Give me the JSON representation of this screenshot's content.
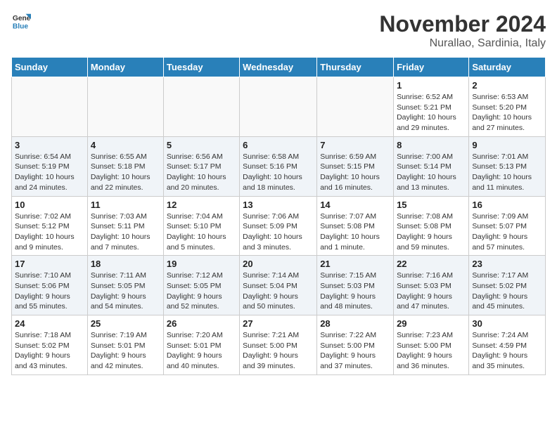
{
  "logo": {
    "line1": "General",
    "line2": "Blue"
  },
  "title": "November 2024",
  "location": "Nurallao, Sardinia, Italy",
  "weekdays": [
    "Sunday",
    "Monday",
    "Tuesday",
    "Wednesday",
    "Thursday",
    "Friday",
    "Saturday"
  ],
  "weeks": [
    [
      {
        "day": "",
        "info": ""
      },
      {
        "day": "",
        "info": ""
      },
      {
        "day": "",
        "info": ""
      },
      {
        "day": "",
        "info": ""
      },
      {
        "day": "",
        "info": ""
      },
      {
        "day": "1",
        "info": "Sunrise: 6:52 AM\nSunset: 5:21 PM\nDaylight: 10 hours\nand 29 minutes."
      },
      {
        "day": "2",
        "info": "Sunrise: 6:53 AM\nSunset: 5:20 PM\nDaylight: 10 hours\nand 27 minutes."
      }
    ],
    [
      {
        "day": "3",
        "info": "Sunrise: 6:54 AM\nSunset: 5:19 PM\nDaylight: 10 hours\nand 24 minutes."
      },
      {
        "day": "4",
        "info": "Sunrise: 6:55 AM\nSunset: 5:18 PM\nDaylight: 10 hours\nand 22 minutes."
      },
      {
        "day": "5",
        "info": "Sunrise: 6:56 AM\nSunset: 5:17 PM\nDaylight: 10 hours\nand 20 minutes."
      },
      {
        "day": "6",
        "info": "Sunrise: 6:58 AM\nSunset: 5:16 PM\nDaylight: 10 hours\nand 18 minutes."
      },
      {
        "day": "7",
        "info": "Sunrise: 6:59 AM\nSunset: 5:15 PM\nDaylight: 10 hours\nand 16 minutes."
      },
      {
        "day": "8",
        "info": "Sunrise: 7:00 AM\nSunset: 5:14 PM\nDaylight: 10 hours\nand 13 minutes."
      },
      {
        "day": "9",
        "info": "Sunrise: 7:01 AM\nSunset: 5:13 PM\nDaylight: 10 hours\nand 11 minutes."
      }
    ],
    [
      {
        "day": "10",
        "info": "Sunrise: 7:02 AM\nSunset: 5:12 PM\nDaylight: 10 hours\nand 9 minutes."
      },
      {
        "day": "11",
        "info": "Sunrise: 7:03 AM\nSunset: 5:11 PM\nDaylight: 10 hours\nand 7 minutes."
      },
      {
        "day": "12",
        "info": "Sunrise: 7:04 AM\nSunset: 5:10 PM\nDaylight: 10 hours\nand 5 minutes."
      },
      {
        "day": "13",
        "info": "Sunrise: 7:06 AM\nSunset: 5:09 PM\nDaylight: 10 hours\nand 3 minutes."
      },
      {
        "day": "14",
        "info": "Sunrise: 7:07 AM\nSunset: 5:08 PM\nDaylight: 10 hours\nand 1 minute."
      },
      {
        "day": "15",
        "info": "Sunrise: 7:08 AM\nSunset: 5:08 PM\nDaylight: 9 hours\nand 59 minutes."
      },
      {
        "day": "16",
        "info": "Sunrise: 7:09 AM\nSunset: 5:07 PM\nDaylight: 9 hours\nand 57 minutes."
      }
    ],
    [
      {
        "day": "17",
        "info": "Sunrise: 7:10 AM\nSunset: 5:06 PM\nDaylight: 9 hours\nand 55 minutes."
      },
      {
        "day": "18",
        "info": "Sunrise: 7:11 AM\nSunset: 5:05 PM\nDaylight: 9 hours\nand 54 minutes."
      },
      {
        "day": "19",
        "info": "Sunrise: 7:12 AM\nSunset: 5:05 PM\nDaylight: 9 hours\nand 52 minutes."
      },
      {
        "day": "20",
        "info": "Sunrise: 7:14 AM\nSunset: 5:04 PM\nDaylight: 9 hours\nand 50 minutes."
      },
      {
        "day": "21",
        "info": "Sunrise: 7:15 AM\nSunset: 5:03 PM\nDaylight: 9 hours\nand 48 minutes."
      },
      {
        "day": "22",
        "info": "Sunrise: 7:16 AM\nSunset: 5:03 PM\nDaylight: 9 hours\nand 47 minutes."
      },
      {
        "day": "23",
        "info": "Sunrise: 7:17 AM\nSunset: 5:02 PM\nDaylight: 9 hours\nand 45 minutes."
      }
    ],
    [
      {
        "day": "24",
        "info": "Sunrise: 7:18 AM\nSunset: 5:02 PM\nDaylight: 9 hours\nand 43 minutes."
      },
      {
        "day": "25",
        "info": "Sunrise: 7:19 AM\nSunset: 5:01 PM\nDaylight: 9 hours\nand 42 minutes."
      },
      {
        "day": "26",
        "info": "Sunrise: 7:20 AM\nSunset: 5:01 PM\nDaylight: 9 hours\nand 40 minutes."
      },
      {
        "day": "27",
        "info": "Sunrise: 7:21 AM\nSunset: 5:00 PM\nDaylight: 9 hours\nand 39 minutes."
      },
      {
        "day": "28",
        "info": "Sunrise: 7:22 AM\nSunset: 5:00 PM\nDaylight: 9 hours\nand 37 minutes."
      },
      {
        "day": "29",
        "info": "Sunrise: 7:23 AM\nSunset: 5:00 PM\nDaylight: 9 hours\nand 36 minutes."
      },
      {
        "day": "30",
        "info": "Sunrise: 7:24 AM\nSunset: 4:59 PM\nDaylight: 9 hours\nand 35 minutes."
      }
    ]
  ]
}
